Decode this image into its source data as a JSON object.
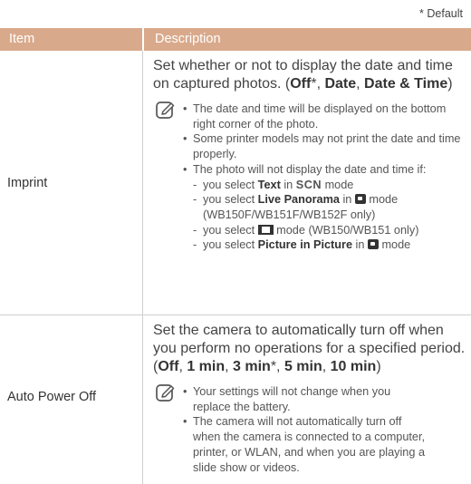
{
  "default_note": "* Default",
  "table": {
    "headers": {
      "item": "Item",
      "description": "Description"
    },
    "rows": [
      {
        "item": "Imprint",
        "lead": {
          "text": "Set whether or not to display the date and time on captured photos. (",
          "opt1": "Off",
          "opt1_mark": "*",
          "sep": ", ",
          "opt2": "Date",
          "opt3": "Date & Time",
          "close": ")"
        },
        "notes": {
          "b1": "The date and time will be displayed on the bottom right corner of the photo.",
          "b2": "Some printer models may not print the date and time properly.",
          "b3": "The photo will not display the date and time if:",
          "s1_pre": "you select ",
          "s1_bold": "Text",
          "s1_mid": " in ",
          "s1_mode": "SCN",
          "s1_post": " mode",
          "s2_pre": "you select ",
          "s2_bold": "Live Panorama",
          "s2_mid": " in ",
          "s2_post": " mode",
          "s2_cont": "(WB150F/WB151F/WB152F only)",
          "s3_pre": "you select ",
          "s3_post": " mode (WB150/WB151 only)",
          "s4_pre": "you select ",
          "s4_bold": "Picture in Picture",
          "s4_mid": " in ",
          "s4_post": " mode"
        }
      },
      {
        "item": "Auto Power Off",
        "lead": {
          "text": "Set the camera to automatically turn off when you perform no operations for a specified period. (",
          "opt1": "Off",
          "sep1": ", ",
          "opt2": "1 min",
          "sep2": ", ",
          "opt3": "3 min",
          "opt3_mark": "*",
          "sep3": ", ",
          "opt4": "5 min",
          "sep4": ", ",
          "opt5": "10 min",
          "close": ")"
        },
        "notes": {
          "b1": "Your settings will not change when you replace the battery.",
          "b2": "The camera will not automatically turn off when the camera is connected to a computer, printer, or WLAN, and when you are playing a slide show or videos."
        }
      }
    ]
  },
  "icons": {
    "note": "note-pencil-icon",
    "smart": "smart-mode-icon",
    "movie": "movie-mode-icon"
  },
  "colors": {
    "header_bg": "#d9a98b",
    "header_text": "#ffffff",
    "divider": "#cfcfcf"
  }
}
